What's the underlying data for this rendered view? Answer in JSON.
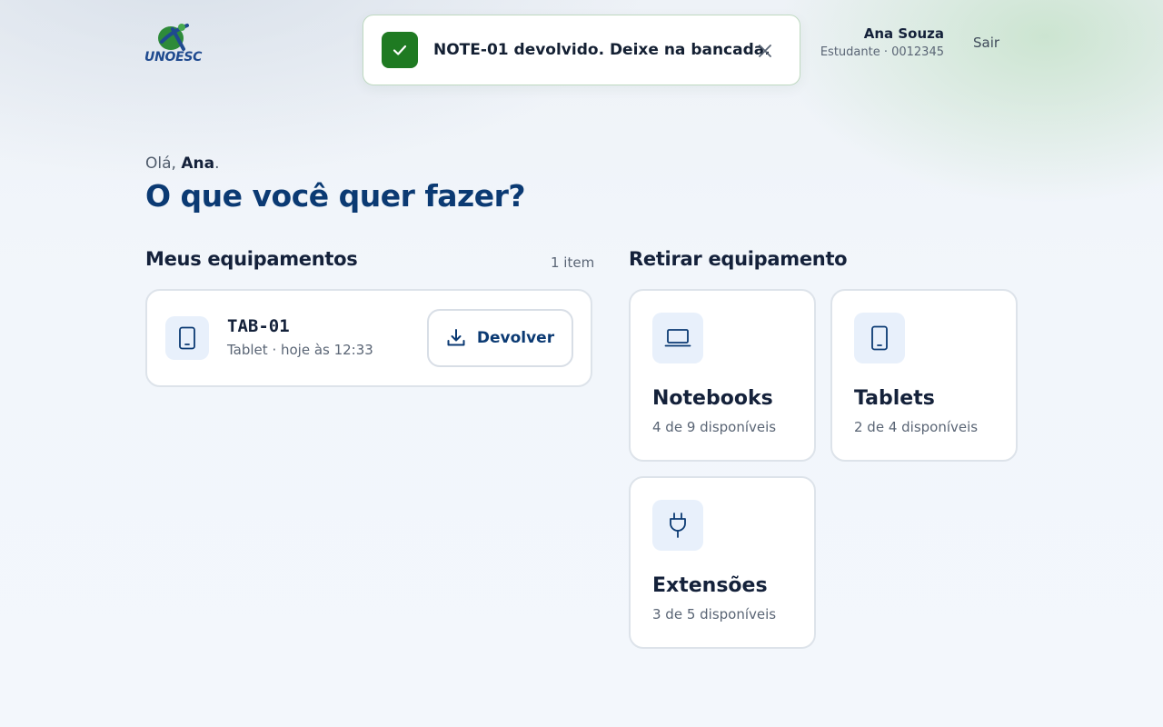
{
  "header": {
    "logo_text": "UNOESC",
    "user_name": "Ana Souza",
    "user_role": "Estudante · 0012345",
    "logout_label": "Sair"
  },
  "toast": {
    "message": "NOTE-01 devolvido. Deixe na bancada.",
    "status_color": "#1f7a22"
  },
  "greeting": {
    "prefix": "Olá, ",
    "name": "Ana",
    "suffix": ".",
    "headline": "O que você quer fazer?"
  },
  "my_equipment": {
    "title": "Meus equipamentos",
    "count": "1 item",
    "items": [
      {
        "code": "TAB-01",
        "detail": "Tablet · hoje às 12:33",
        "icon": "tablet-icon",
        "action_label": "Devolver"
      }
    ]
  },
  "checkout": {
    "title": "Retirar equipamento",
    "categories": [
      {
        "name": "Notebooks",
        "availability": "4 de 9 disponíveis",
        "icon": "laptop-icon"
      },
      {
        "name": "Tablets",
        "availability": "2 de 4 disponíveis",
        "icon": "tablet-icon"
      },
      {
        "name": "Extensões",
        "availability": "3 de 5 disponíveis",
        "icon": "plug-icon"
      }
    ]
  },
  "colors": {
    "brand_blue": "#0b3a73",
    "icon_bg": "#e8f0fb",
    "success_green": "#1f7a22"
  }
}
